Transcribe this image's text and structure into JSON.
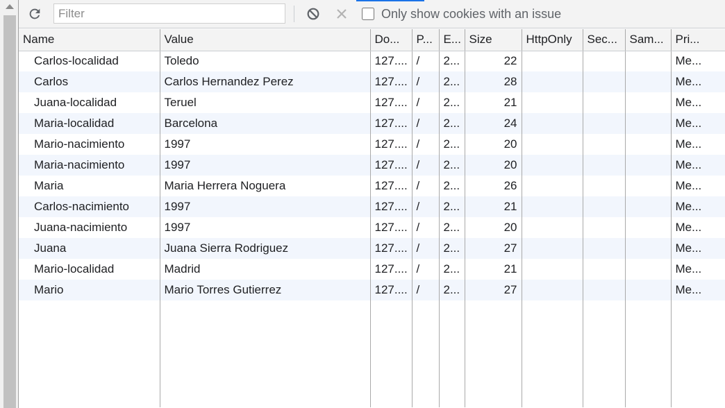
{
  "toolbar": {
    "filter_placeholder": "Filter",
    "only_issues_label": "Only show cookies with an issue",
    "only_issues_checked": false
  },
  "icons": {
    "refresh": "refresh-icon",
    "clear": "clear-icon",
    "delete": "close-icon"
  },
  "colors": {
    "accent": "#1a73e8",
    "stripe": "#f2f6fd",
    "header_bg": "#f3f3f3"
  },
  "table": {
    "columns": [
      "Name",
      "Value",
      "Do...",
      "P...",
      "E...",
      "Size",
      "HttpOnly",
      "Sec...",
      "Sam...",
      "Pri..."
    ],
    "rows": [
      {
        "name": "Carlos-localidad",
        "value": "Toledo",
        "domain": "127....",
        "path": "/",
        "expires": "2...",
        "size": "22",
        "httponly": "",
        "secure": "",
        "samesite": "",
        "priority": "Me..."
      },
      {
        "name": "Carlos",
        "value": "Carlos Hernandez Perez",
        "domain": "127....",
        "path": "/",
        "expires": "2...",
        "size": "28",
        "httponly": "",
        "secure": "",
        "samesite": "",
        "priority": "Me..."
      },
      {
        "name": "Juana-localidad",
        "value": "Teruel",
        "domain": "127....",
        "path": "/",
        "expires": "2...",
        "size": "21",
        "httponly": "",
        "secure": "",
        "samesite": "",
        "priority": "Me..."
      },
      {
        "name": "Maria-localidad",
        "value": "Barcelona",
        "domain": "127....",
        "path": "/",
        "expires": "2...",
        "size": "24",
        "httponly": "",
        "secure": "",
        "samesite": "",
        "priority": "Me..."
      },
      {
        "name": "Mario-nacimiento",
        "value": "1997",
        "domain": "127....",
        "path": "/",
        "expires": "2...",
        "size": "20",
        "httponly": "",
        "secure": "",
        "samesite": "",
        "priority": "Me..."
      },
      {
        "name": "Maria-nacimiento",
        "value": "1997",
        "domain": "127....",
        "path": "/",
        "expires": "2...",
        "size": "20",
        "httponly": "",
        "secure": "",
        "samesite": "",
        "priority": "Me..."
      },
      {
        "name": "Maria",
        "value": "Maria Herrera Noguera",
        "domain": "127....",
        "path": "/",
        "expires": "2...",
        "size": "26",
        "httponly": "",
        "secure": "",
        "samesite": "",
        "priority": "Me..."
      },
      {
        "name": "Carlos-nacimiento",
        "value": "1997",
        "domain": "127....",
        "path": "/",
        "expires": "2...",
        "size": "21",
        "httponly": "",
        "secure": "",
        "samesite": "",
        "priority": "Me..."
      },
      {
        "name": "Juana-nacimiento",
        "value": "1997",
        "domain": "127....",
        "path": "/",
        "expires": "2...",
        "size": "20",
        "httponly": "",
        "secure": "",
        "samesite": "",
        "priority": "Me..."
      },
      {
        "name": "Juana",
        "value": "Juana Sierra Rodriguez",
        "domain": "127....",
        "path": "/",
        "expires": "2...",
        "size": "27",
        "httponly": "",
        "secure": "",
        "samesite": "",
        "priority": "Me..."
      },
      {
        "name": "Mario-localidad",
        "value": "Madrid",
        "domain": "127....",
        "path": "/",
        "expires": "2...",
        "size": "21",
        "httponly": "",
        "secure": "",
        "samesite": "",
        "priority": "Me..."
      },
      {
        "name": "Mario",
        "value": "Mario Torres Gutierrez",
        "domain": "127....",
        "path": "/",
        "expires": "2...",
        "size": "27",
        "httponly": "",
        "secure": "",
        "samesite": "",
        "priority": "Me..."
      }
    ]
  }
}
